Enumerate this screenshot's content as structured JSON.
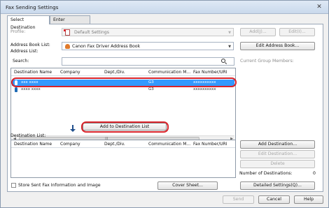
{
  "window": {
    "title": "Fax Sending Settings",
    "close_glyph": "✕"
  },
  "tabs": [
    {
      "label": "Select Destination"
    },
    {
      "label": "Enter Destination"
    }
  ],
  "profile": {
    "label": "Profile:",
    "value": "Default Settings",
    "add_button": "Add(J)...",
    "edit_button": "Edit(I)..."
  },
  "address_book": {
    "label": "Address Book List:",
    "value": "Canon Fax Driver Address Book",
    "edit_button": "Edit Address Book..."
  },
  "address_list": {
    "label": "Address List:",
    "search_label": "Search:",
    "current_group_members_label": "Current Group Members:",
    "columns": [
      "Destination Name",
      "Company",
      "Dept./Div.",
      "Communication M...",
      "Fax Number/URI"
    ],
    "rows": [
      {
        "name": "xxx xxxx",
        "company": "",
        "dept": "",
        "mode": "G3",
        "fax": "xxxxxxxxxx",
        "selected": true
      },
      {
        "name": "xxxx xxxx",
        "company": "",
        "dept": "",
        "mode": "G3",
        "fax": "xxxxxxxxxx",
        "selected": false
      }
    ],
    "scroll_glyphs": {
      "left": "◀",
      "right": "▶",
      "grip": "III"
    }
  },
  "add_to_destination_button": "Add to Destination List",
  "destination_list": {
    "label": "Destination List:",
    "columns": [
      "Destination Name",
      "Company",
      "Dept./Div.",
      "Communication M...",
      "Fax Number/URI"
    ],
    "add_button": "Add Destination...",
    "edit_button": "Edit Destination...",
    "delete_button": "Delete",
    "count_label": "Number of Destinations:",
    "count_value": "0"
  },
  "store_checkbox_label": "Store Sent Fax Information and Image",
  "cover_sheet_button": "Cover Sheet...",
  "detailed_settings_button": "Detailed Settings(Q)...",
  "footer": {
    "send": "Send",
    "cancel": "Cancel",
    "help": "Help"
  },
  "colors": {
    "selection": "#3399ff",
    "highlight_oval": "#d8232a",
    "arrow": "#1f4e8c"
  }
}
